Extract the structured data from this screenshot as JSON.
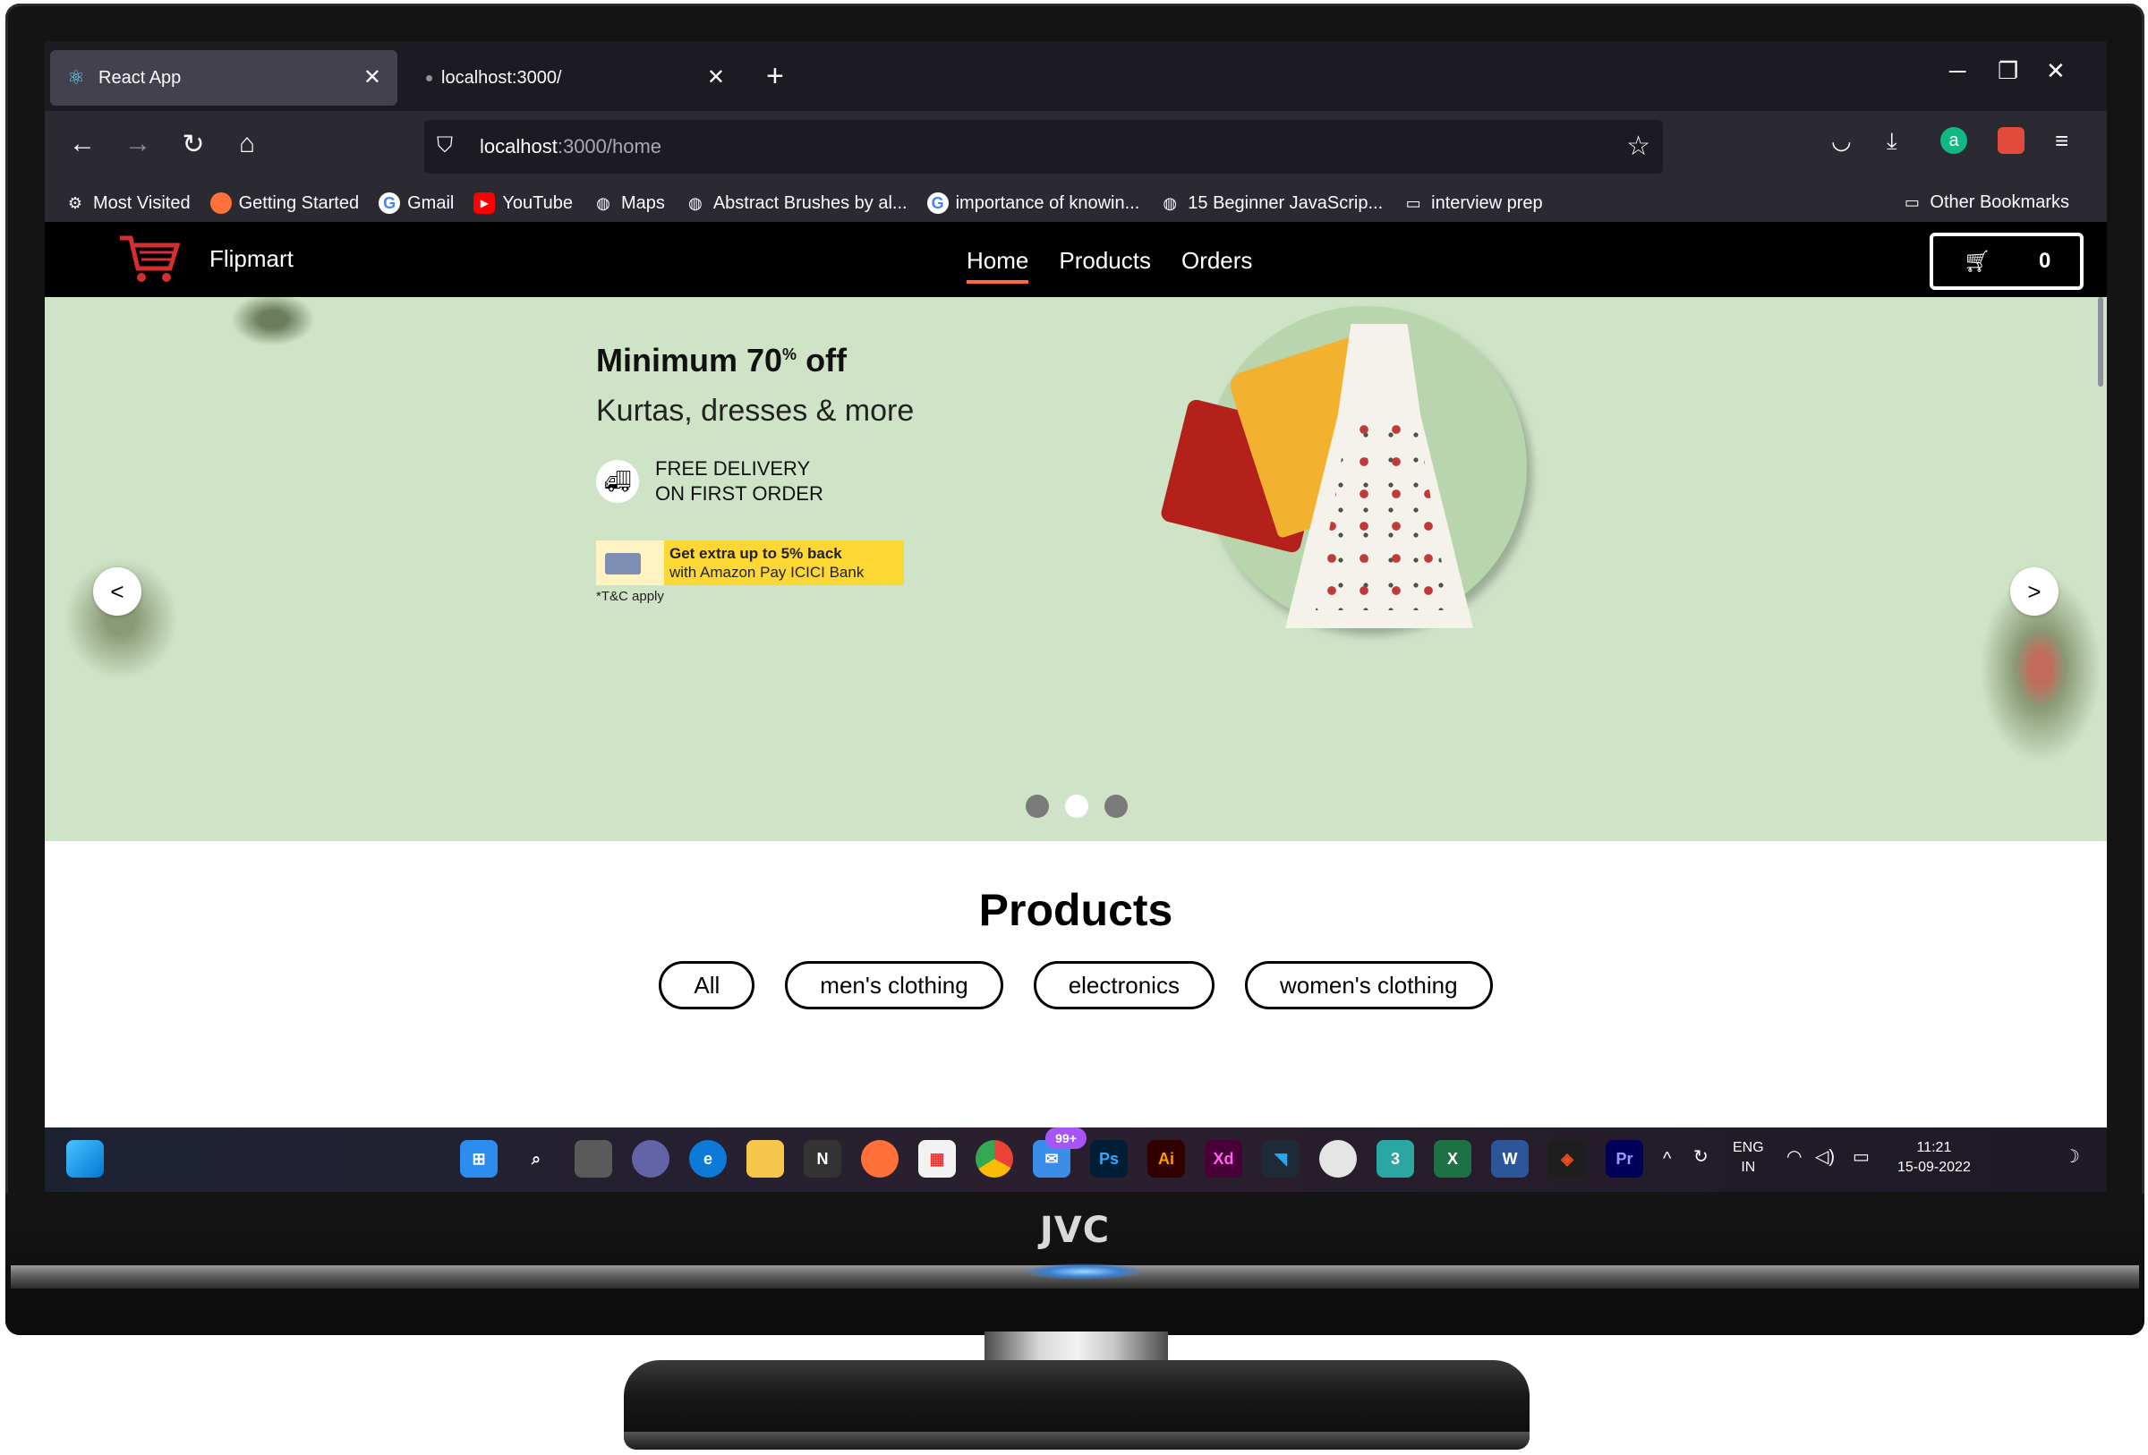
{
  "browser": {
    "tabs": [
      {
        "title": "React App",
        "active": true
      },
      {
        "title": "localhost:3000/",
        "active": false
      }
    ],
    "url_host": "localhost",
    "url_rest": ":3000/home",
    "bookmarks": [
      {
        "label": "Most Visited",
        "icon": "gear-icon"
      },
      {
        "label": "Getting Started",
        "icon": "firefox-icon"
      },
      {
        "label": "Gmail",
        "icon": "google-icon"
      },
      {
        "label": "YouTube",
        "icon": "youtube-icon"
      },
      {
        "label": "Maps",
        "icon": "globe-icon"
      },
      {
        "label": "Abstract Brushes by al...",
        "icon": "globe-icon"
      },
      {
        "label": "importance of knowin...",
        "icon": "google-icon"
      },
      {
        "label": "15 Beginner JavaScrip...",
        "icon": "globe-icon"
      },
      {
        "label": "interview prep",
        "icon": "folder-icon"
      }
    ],
    "other_bookmarks": "Other Bookmarks"
  },
  "app": {
    "brand": "Flipmart",
    "nav": [
      "Home",
      "Products",
      "Orders"
    ],
    "cart_count": "0"
  },
  "hero": {
    "title": "Minimum 70",
    "title_sup": "%",
    "title_end": " off",
    "subtitle": "Kurtas, dresses & more",
    "delivery_line1": "FREE DELIVERY",
    "delivery_line2": "ON FIRST ORDER",
    "offer_line1": "Get extra up to 5% back",
    "offer_line2": "with Amazon Pay ICICI Bank",
    "tnc": "*T&C apply",
    "prev": "<",
    "next": ">",
    "slides": 3,
    "active_slide": 2
  },
  "products": {
    "heading": "Products",
    "filters": [
      "All",
      "men's clothing",
      "electronics",
      "women's clothing"
    ]
  },
  "taskbar": {
    "badge": "99+",
    "lang1": "ENG",
    "lang2": "IN",
    "time": "11:21",
    "date": "15-09-2022"
  },
  "monitor": {
    "brand": "JVC"
  }
}
